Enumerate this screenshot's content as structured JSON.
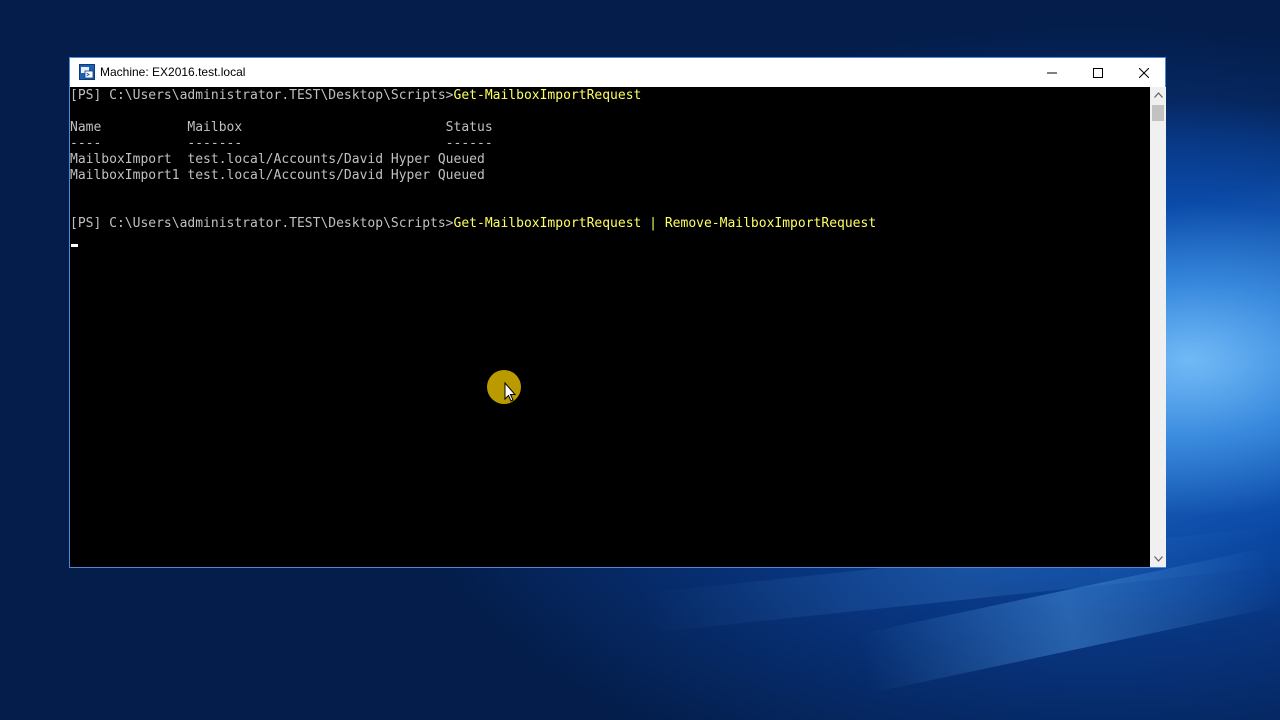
{
  "window": {
    "title": "Machine: EX2016.test.local"
  },
  "console": {
    "lines": [
      {
        "prompt": "[PS] C:\\Users\\administrator.TEST\\Desktop\\Scripts>",
        "command": "Get-MailboxImportRequest"
      },
      {
        "text": ""
      },
      {
        "text": "Name           Mailbox                          Status"
      },
      {
        "text": "----           -------                          ------"
      },
      {
        "text": "MailboxImport  test.local/Accounts/David Hyper Queued"
      },
      {
        "text": "MailboxImport1 test.local/Accounts/David Hyper Queued"
      },
      {
        "text": ""
      },
      {
        "text": ""
      },
      {
        "prompt": "[PS] C:\\Users\\administrator.TEST\\Desktop\\Scripts>",
        "command": "Get-MailboxImportRequest | Remove-MailboxImportRequest"
      }
    ]
  },
  "colors": {
    "console_background": "#000000",
    "console_text": "#c0c0c0",
    "command_text": "#ffff60",
    "cursor_highlight": "#c9a800"
  },
  "icons": {
    "app": "powershell-remote-icon",
    "minimize": "minimize-icon",
    "maximize": "maximize-icon",
    "close": "close-icon",
    "scroll_up": "chevron-up-icon",
    "scroll_down": "chevron-down-icon",
    "pointer": "mouse-pointer-icon"
  }
}
